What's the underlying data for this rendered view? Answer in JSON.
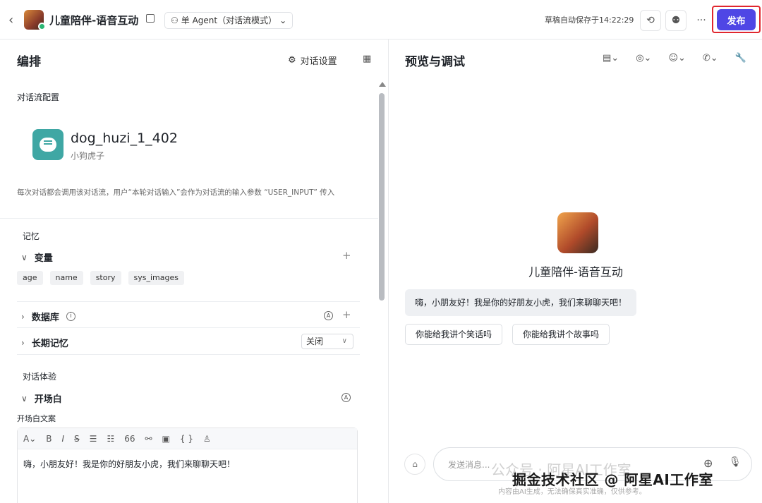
{
  "header": {
    "title": "儿童陪伴-语音互动",
    "mode": "单 Agent（对话流模式）",
    "saved_text": "草稿自动保存于14:22:29",
    "publish_label": "发布"
  },
  "left": {
    "title": "编排",
    "dialog_settings": "对话设置",
    "workflow_section": "对话流配置",
    "workflow": {
      "name": "dog_huzi_1_402",
      "desc": "小狗虎子"
    },
    "note": "每次对话都会调用该对话流，用户“本轮对话输入”会作为对话流的输入参数 “USER_INPUT” 传入",
    "memory_label": "记忆",
    "variables_label": "变量",
    "variables": [
      "age",
      "name",
      "story",
      "sys_images"
    ],
    "database_label": "数据库",
    "longterm_label": "长期记忆",
    "longterm_value": "关闭",
    "experience_label": "对话体验",
    "opening_label": "开场白",
    "opening_copy_label": "开场白文案",
    "opening_text": "嗨，小朋友好！我是你的好朋友小虎，我们来聊聊天吧！"
  },
  "right": {
    "title": "预览与调试",
    "bot_name": "儿童陪伴-语音互动",
    "greeting": "嗨，小朋友好！我是你的好朋友小虎，我们来聊聊天吧！",
    "suggestions": [
      "你能给我讲个笑话吗",
      "你能给我讲个故事吗"
    ],
    "input_placeholder": "发送消息...",
    "disclaimer": "内容由AI生成，无法确保真实准确，仅供参考。"
  },
  "watermark": {
    "line1": "公众号 · 阿星AI工作室",
    "line2": "掘金技术社区 @ 阿星AI工作室"
  }
}
